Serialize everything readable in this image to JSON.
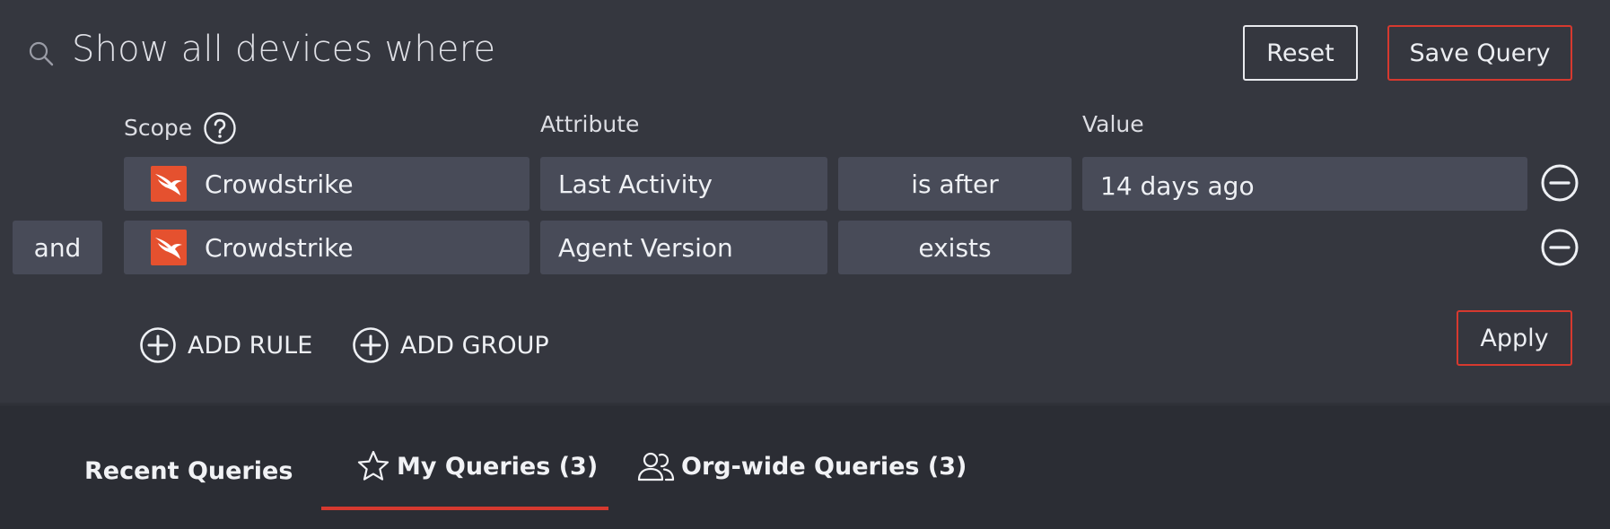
{
  "header": {
    "title": "Show all devices where",
    "reset_label": "Reset",
    "save_label": "Save Query"
  },
  "columns": {
    "scope": "Scope",
    "attribute": "Attribute",
    "value": "Value"
  },
  "rules": [
    {
      "connector": "",
      "scope": "Crowdstrike",
      "attribute": "Last Activity",
      "operator": "is after",
      "value": "14 days ago"
    },
    {
      "connector": "and",
      "scope": "Crowdstrike",
      "attribute": "Agent Version",
      "operator": "exists",
      "value": ""
    }
  ],
  "actions": {
    "add_rule": "ADD RULE",
    "add_group": "ADD GROUP",
    "apply": "Apply"
  },
  "tabs": [
    {
      "label": "Recent Queries",
      "icon": ""
    },
    {
      "label": "My Queries (3)",
      "icon": "star-icon",
      "active": true
    },
    {
      "label": "Org-wide Queries (3)",
      "icon": "users-icon"
    }
  ],
  "colors": {
    "background": "#35373f",
    "field": "#484b58",
    "accent_red": "#d6392f",
    "crowdstrike": "#e5512f"
  }
}
